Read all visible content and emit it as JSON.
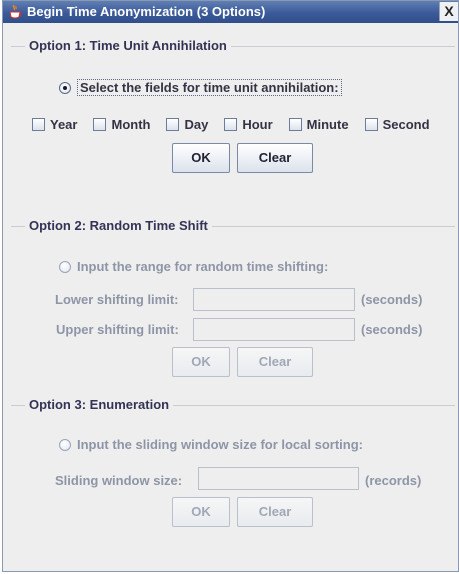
{
  "window": {
    "title": "Begin Time Anonymization (3 Options)",
    "close_symbol": "X"
  },
  "option1": {
    "title": "Option 1: Time Unit Annihilation",
    "radio_label": "Select the fields for time unit annihilation:",
    "radio_selected": true,
    "checkboxes": [
      "Year",
      "Month",
      "Day",
      "Hour",
      "Minute",
      "Second"
    ],
    "ok_label": "OK",
    "clear_label": "Clear"
  },
  "option2": {
    "title": "Option 2: Random Time Shift",
    "radio_label": "Input the range for random time shifting:",
    "radio_selected": false,
    "lower_label": "Lower shifting limit:",
    "lower_value": "",
    "lower_unit": "(seconds)",
    "upper_label": "Upper shifting limit:",
    "upper_value": "",
    "upper_unit": "(seconds)",
    "ok_label": "OK",
    "clear_label": "Clear"
  },
  "option3": {
    "title": "Option 3: Enumeration",
    "radio_label": "Input the sliding window size for local sorting:",
    "radio_selected": false,
    "window_label": "Sliding window size:",
    "window_value": "",
    "window_unit": "(records)",
    "ok_label": "OK",
    "clear_label": "Clear"
  },
  "colors": {
    "titlebar": "#3b5a99",
    "background": "#eeeeee",
    "disabled_text": "#8d95a6"
  },
  "icons": {
    "window_icon": "java-cup-icon",
    "close_icon": "close-icon"
  }
}
